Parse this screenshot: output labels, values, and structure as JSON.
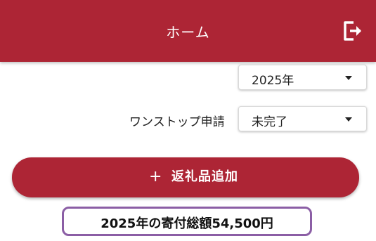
{
  "header": {
    "title": "ホーム",
    "logout_icon": "logout-icon",
    "color": "#ad2535"
  },
  "filters": {
    "year_selected": "2025年",
    "onestop_label": "ワンストップ申請",
    "onestop_selected": "未完了"
  },
  "actions": {
    "add_plus": "+",
    "add_label": "返礼品追加"
  },
  "summary": {
    "total_text": "2025年の寄付総額54,500円",
    "highlight_color": "#8b5ea5"
  }
}
